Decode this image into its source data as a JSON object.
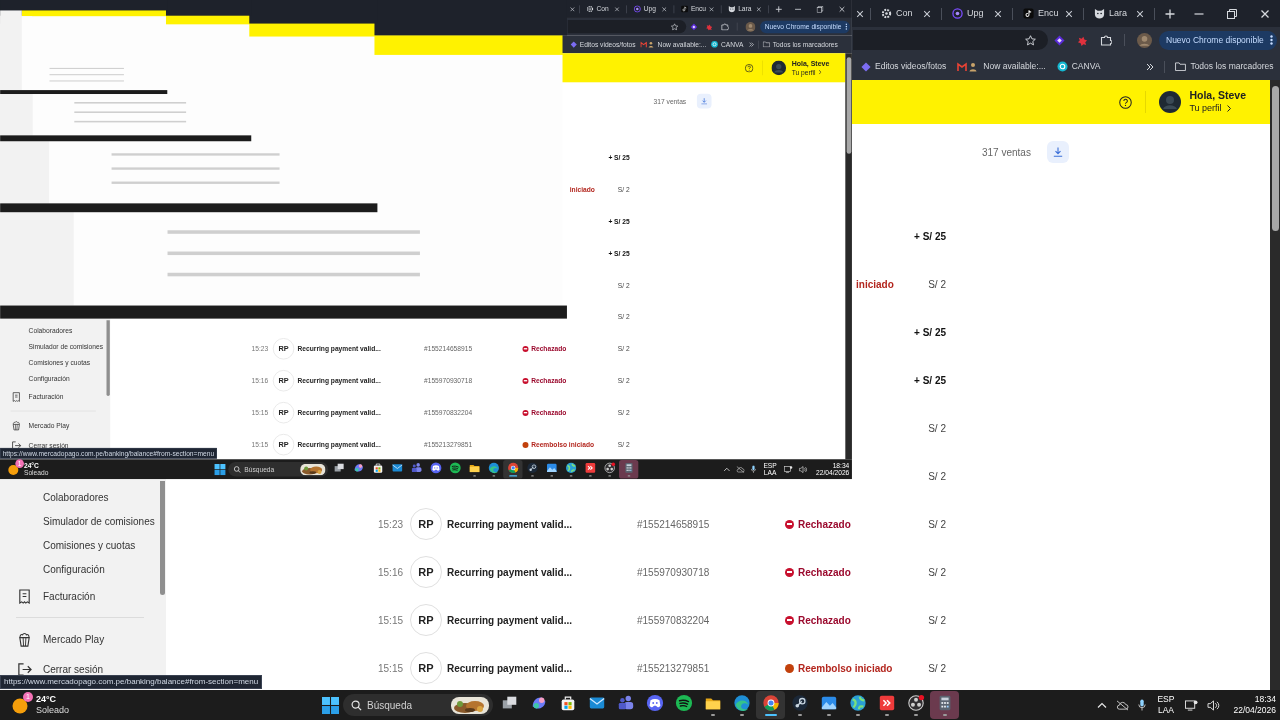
{
  "screenshot": {
    "tabs": [
      {
        "label": "Con",
        "selected": false
      },
      {
        "label": "Upg",
        "selected": false
      },
      {
        "label": "Encu",
        "selected": false
      },
      {
        "label": "Lara",
        "selected": false
      }
    ],
    "update_button": "Nuevo Chrome disponible",
    "bookmarks": [
      {
        "label": "Editos videos/fotos"
      },
      {
        "label": "Now available:..."
      },
      {
        "label": "CANVA"
      }
    ],
    "bookmarks_folder": "Todos los marcadores",
    "user": {
      "greeting": "Hola, Steve",
      "link": "Tu perfil"
    },
    "sales_count": "317 ventas",
    "sidebar": {
      "sections": [
        {
          "items": [
            {
              "label": "Colaboradores",
              "kind": "subitem"
            },
            {
              "label": "Simulador de comisiones",
              "kind": "subitem"
            },
            {
              "label": "Comisiones y cuotas",
              "kind": "subitem"
            },
            {
              "label": "Configuración",
              "kind": "subitem"
            },
            {
              "label": "Facturación",
              "kind": "item"
            }
          ]
        },
        {
          "items": [
            {
              "label": "Mercado Play",
              "kind": "item"
            },
            {
              "label": "Cerrar sesión",
              "kind": "item"
            }
          ]
        }
      ]
    },
    "transactions": [
      {
        "amount": "+ S/ 25",
        "credit": true
      },
      {
        "status": {
          "label": "iniciado",
          "kind": "refund"
        },
        "amount": "S/ 2",
        "credit": false
      },
      {
        "amount": "+ S/ 25",
        "credit": true
      },
      {
        "amount": "+ S/ 25",
        "credit": true
      },
      {
        "amount": "S/ 2",
        "credit": false
      },
      {
        "amount": "S/ 2",
        "credit": false
      },
      {
        "time": "15:23",
        "initials": "RP",
        "title": "Recurring payment valid...",
        "id": "#155214658915",
        "status": {
          "label": "Rechazado",
          "kind": "rejected",
          "color": "#c8102e"
        },
        "amount": "S/ 2",
        "credit": false
      },
      {
        "time": "15:16",
        "initials": "RP",
        "title": "Recurring payment valid...",
        "id": "#155970930718",
        "status": {
          "label": "Rechazado",
          "kind": "rejected",
          "color": "#c8102e"
        },
        "amount": "S/ 2",
        "credit": false
      },
      {
        "time": "15:15",
        "initials": "RP",
        "title": "Recurring payment valid...",
        "id": "#155970832204",
        "status": {
          "label": "Rechazado",
          "kind": "rejected",
          "color": "#c8102e"
        },
        "amount": "S/ 2",
        "credit": false
      },
      {
        "time": "15:15",
        "initials": "RP",
        "title": "Recurring payment valid...",
        "id": "#155213279851",
        "status": {
          "label": "Reembolso iniciado",
          "kind": "refund",
          "color": "#c2410c"
        },
        "amount": "S/ 2",
        "credit": false
      }
    ],
    "status_url": "https://www.mercadopago.com.pe/banking/balance#from-section=menu",
    "taskbar": {
      "weather": {
        "temperature": "24°C",
        "condition": "Soleado",
        "badge": "1"
      },
      "search_placeholder": "Búsqueda",
      "apps": [
        {
          "running": false,
          "active": false,
          "highlighted": false
        },
        {
          "running": false,
          "active": false,
          "highlighted": false
        },
        {
          "running": false,
          "active": false,
          "highlighted": false
        },
        {
          "running": false,
          "active": false,
          "highlighted": false
        },
        {
          "running": false,
          "active": false,
          "highlighted": false
        },
        {
          "running": false,
          "active": false,
          "highlighted": false
        },
        {
          "running": false,
          "active": false,
          "highlighted": false
        },
        {
          "running": true,
          "active": false,
          "highlighted": false
        },
        {
          "running": true,
          "active": false,
          "highlighted": false
        },
        {
          "running": true,
          "active": true,
          "highlighted": false
        },
        {
          "running": true,
          "active": false,
          "highlighted": false
        },
        {
          "running": true,
          "active": false,
          "highlighted": false
        },
        {
          "running": true,
          "active": false,
          "highlighted": false
        },
        {
          "running": true,
          "active": false,
          "highlighted": false
        },
        {
          "running": true,
          "active": false,
          "highlighted": false
        },
        {
          "running": true,
          "active": false,
          "highlighted": true
        }
      ],
      "tray": {
        "language": "ESP",
        "layout": "LAA",
        "time": "18:34",
        "date": "22/04/2026"
      }
    }
  },
  "tabs": [
    {
      "label": "Con",
      "selected": false
    },
    {
      "label": "Upg",
      "selected": false
    },
    {
      "label": "Encu",
      "selected": false
    },
    {
      "label": "Lara",
      "selected": false
    }
  ],
  "update_button": "Nuevo Chrome disponible",
  "bookmarks": [
    {
      "label": "Editos videos/fotos"
    },
    {
      "label": "Now available:..."
    },
    {
      "label": "CANVA"
    }
  ],
  "bookmarks_folder": "Todos los marcadores",
  "user": {
    "greeting": "Hola, Steve",
    "link": "Tu perfil"
  },
  "sales_count": "317 ventas",
  "sidebar": {
    "sections": [
      {
        "items": [
          {
            "label": "Colaboradores",
            "kind": "subitem"
          },
          {
            "label": "Simulador de comisiones",
            "kind": "subitem"
          },
          {
            "label": "Comisiones y cuotas",
            "kind": "subitem"
          },
          {
            "label": "Configuración",
            "kind": "subitem"
          },
          {
            "label": "Facturación",
            "kind": "item"
          }
        ]
      },
      {
        "items": [
          {
            "label": "Mercado Play",
            "kind": "item"
          },
          {
            "label": "Cerrar sesión",
            "kind": "item"
          }
        ]
      }
    ]
  },
  "transactions": [
    {
      "amount": "+ S/ 25",
      "credit": true
    },
    {
      "status": {
        "label": "iniciado",
        "kind": "refund"
      },
      "amount": "S/ 2",
      "credit": false
    },
    {
      "amount": "+ S/ 25",
      "credit": true
    },
    {
      "amount": "+ S/ 25",
      "credit": true
    },
    {
      "amount": "S/ 2",
      "credit": false
    },
    {
      "amount": "S/ 2",
      "credit": false
    },
    {
      "time": "15:23",
      "initials": "RP",
      "title": "Recurring payment valid...",
      "id": "#155214658915",
      "status": {
        "label": "Rechazado",
        "kind": "rejected",
        "color": "#c8102e"
      },
      "amount": "S/ 2",
      "credit": false
    },
    {
      "time": "15:16",
      "initials": "RP",
      "title": "Recurring payment valid...",
      "id": "#155970930718",
      "status": {
        "label": "Rechazado",
        "kind": "rejected",
        "color": "#c8102e"
      },
      "amount": "S/ 2",
      "credit": false
    },
    {
      "time": "15:15",
      "initials": "RP",
      "title": "Recurring payment valid...",
      "id": "#155970832204",
      "status": {
        "label": "Rechazado",
        "kind": "rejected",
        "color": "#c8102e"
      },
      "amount": "S/ 2",
      "credit": false
    },
    {
      "time": "15:15",
      "initials": "RP",
      "title": "Recurring payment valid...",
      "id": "#155213279851",
      "status": {
        "label": "Reembolso iniciado",
        "kind": "refund",
        "color": "#c2410c"
      },
      "amount": "S/ 2",
      "credit": false
    }
  ],
  "status_url": "https://www.mercadopago.com.pe/banking/balance#from-section=menu",
  "taskbar": {
    "weather": {
      "temperature": "24°C",
      "condition": "Soleado",
      "badge": "1"
    },
    "search_placeholder": "Búsqueda",
    "apps": [
      {
        "running": false,
        "active": false,
        "highlighted": false
      },
      {
        "running": false,
        "active": false,
        "highlighted": false
      },
      {
        "running": false,
        "active": false,
        "highlighted": false
      },
      {
        "running": false,
        "active": false,
        "highlighted": false
      },
      {
        "running": false,
        "active": false,
        "highlighted": false
      },
      {
        "running": false,
        "active": false,
        "highlighted": false
      },
      {
        "running": false,
        "active": false,
        "highlighted": false
      },
      {
        "running": true,
        "active": false,
        "highlighted": false
      },
      {
        "running": true,
        "active": false,
        "highlighted": false
      },
      {
        "running": true,
        "active": true,
        "highlighted": false
      },
      {
        "running": true,
        "active": false,
        "highlighted": false
      },
      {
        "running": true,
        "active": false,
        "highlighted": false
      },
      {
        "running": true,
        "active": false,
        "highlighted": false
      },
      {
        "running": true,
        "active": false,
        "highlighted": false
      },
      {
        "running": true,
        "active": false,
        "highlighted": false
      },
      {
        "running": true,
        "active": false,
        "highlighted": true
      }
    ],
    "tray": {
      "language": "ESP",
      "layout": "LAA",
      "time": "18:34",
      "date": "22/04/2026"
    }
  }
}
